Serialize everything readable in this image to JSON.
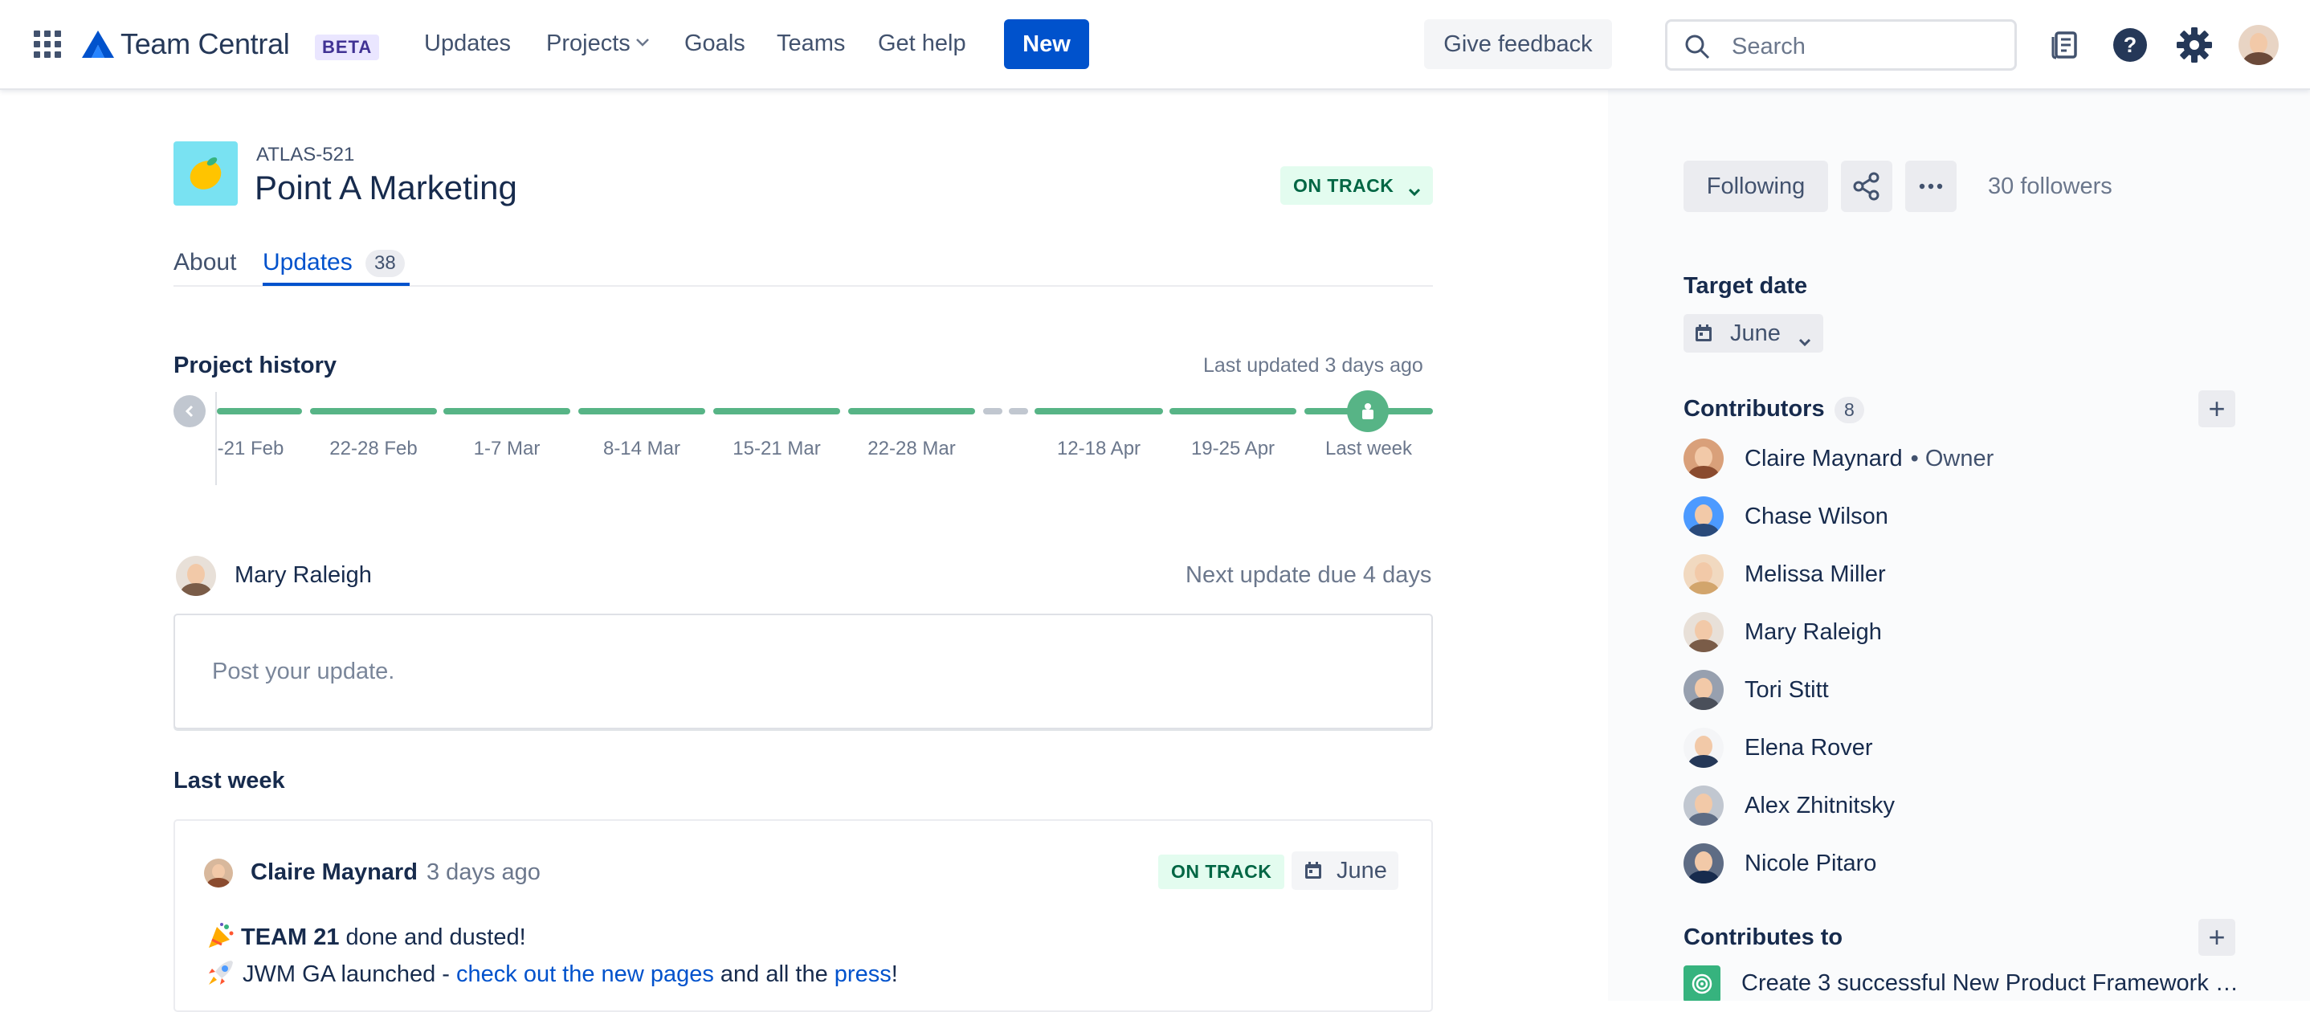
{
  "topnav": {
    "product_name": "Team Central",
    "beta_label": "BETA",
    "links": [
      "Updates",
      "Projects",
      "Goals",
      "Teams",
      "Get help"
    ],
    "new_label": "New",
    "feedback_label": "Give feedback",
    "search_placeholder": "Search",
    "icons": [
      "app-switcher-icon",
      "whats-new-icon",
      "help-icon",
      "settings-icon",
      "profile-avatar"
    ]
  },
  "project": {
    "key": "ATLAS-521",
    "title": "Point A Marketing",
    "icon": "lemon-emoji",
    "status": "ON TRACK",
    "status_color": "#e3fcef"
  },
  "tabs": [
    {
      "label": "About"
    },
    {
      "label": "Updates",
      "count": "38"
    }
  ],
  "history": {
    "title": "Project history",
    "last_updated": "Last updated 3 days ago",
    "weeks": [
      "-21 Feb",
      "22-28 Feb",
      "1-7 Mar",
      "8-14 Mar",
      "15-21 Mar",
      "22-28 Mar",
      "12-18 Apr",
      "19-25 Apr",
      "Last week"
    ]
  },
  "composer": {
    "author": "Mary Raleigh",
    "next_due": "Next update due 4 days",
    "placeholder": "Post your update."
  },
  "feed": {
    "section": "Last week",
    "update": {
      "author": "Claire Maynard",
      "time": "3 days ago",
      "status": "ON TRACK",
      "target": "June",
      "line1_bold": "TEAM 21",
      "line1_rest": " done and dusted!",
      "line2_pre": " JWM GA launched - ",
      "line2_link1": "check out the new pages",
      "line2_mid": " and all the ",
      "line2_link2": "press",
      "line2_post": "!"
    }
  },
  "sidebar": {
    "following_label": "Following",
    "followers": "30 followers",
    "target_date_label": "Target date",
    "target_date": "June",
    "contributors_label": "Contributors",
    "contributors_count": "8",
    "contributors": [
      {
        "name": "Claire Maynard",
        "role": "• Owner"
      },
      {
        "name": "Chase Wilson"
      },
      {
        "name": "Melissa Miller"
      },
      {
        "name": "Mary Raleigh"
      },
      {
        "name": "Tori Stitt"
      },
      {
        "name": "Elena Rover"
      },
      {
        "name": "Alex Zhitnitsky"
      },
      {
        "name": "Nicole Pitaro"
      }
    ],
    "contributes_to_label": "Contributes to",
    "goal": "Create 3 successful New Product Framework …"
  },
  "colors": {
    "accent": "#0052cc",
    "on_track_bg": "#e3fcef",
    "on_track_text": "#006644",
    "timeline_green": "#57b486"
  }
}
